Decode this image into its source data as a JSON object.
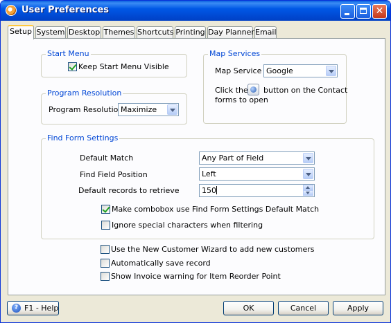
{
  "window": {
    "title": "User Preferences"
  },
  "tabs": [
    "Setup",
    "System",
    "Desktop",
    "Themes",
    "Shortcuts",
    "Printing",
    "Day Planner",
    "Email"
  ],
  "start_menu": {
    "title": "Start Menu",
    "keep_visible_label": "Keep Start Menu Visible",
    "keep_visible_checked": true
  },
  "program_resolution": {
    "title": "Program Resolution",
    "label": "Program Resolution",
    "value": "Maximize"
  },
  "map_services": {
    "title": "Map Services",
    "label": "Map Service",
    "value": "Google",
    "hint_before": "Click the",
    "hint_after": "button on the Contact",
    "hint_line2": "forms to open"
  },
  "find_form": {
    "title": "Find Form Settings",
    "default_match_label": "Default Match",
    "default_match_value": "Any Part of Field",
    "field_position_label": "Find Field Position",
    "field_position_value": "Left",
    "records_label": "Default records to retrieve",
    "records_value": "150",
    "combobox_default_label": "Make combobox use Find Form Settings Default Match",
    "combobox_default_checked": true,
    "ignore_special_label": "Ignore special characters when filtering",
    "ignore_special_checked": false
  },
  "options": {
    "new_customer_wizard_label": "Use the New Customer Wizard to add new customers",
    "auto_save_label": "Automatically save record",
    "invoice_warning_label": "Show Invoice warning for Item Reorder Point"
  },
  "buttons": {
    "help": "F1 - Help",
    "ok": "OK",
    "cancel": "Cancel",
    "apply": "Apply"
  },
  "colors": {
    "title_bar": "#0058e6",
    "group_title": "#0046d5",
    "tab_highlight": "#ffc83c"
  }
}
